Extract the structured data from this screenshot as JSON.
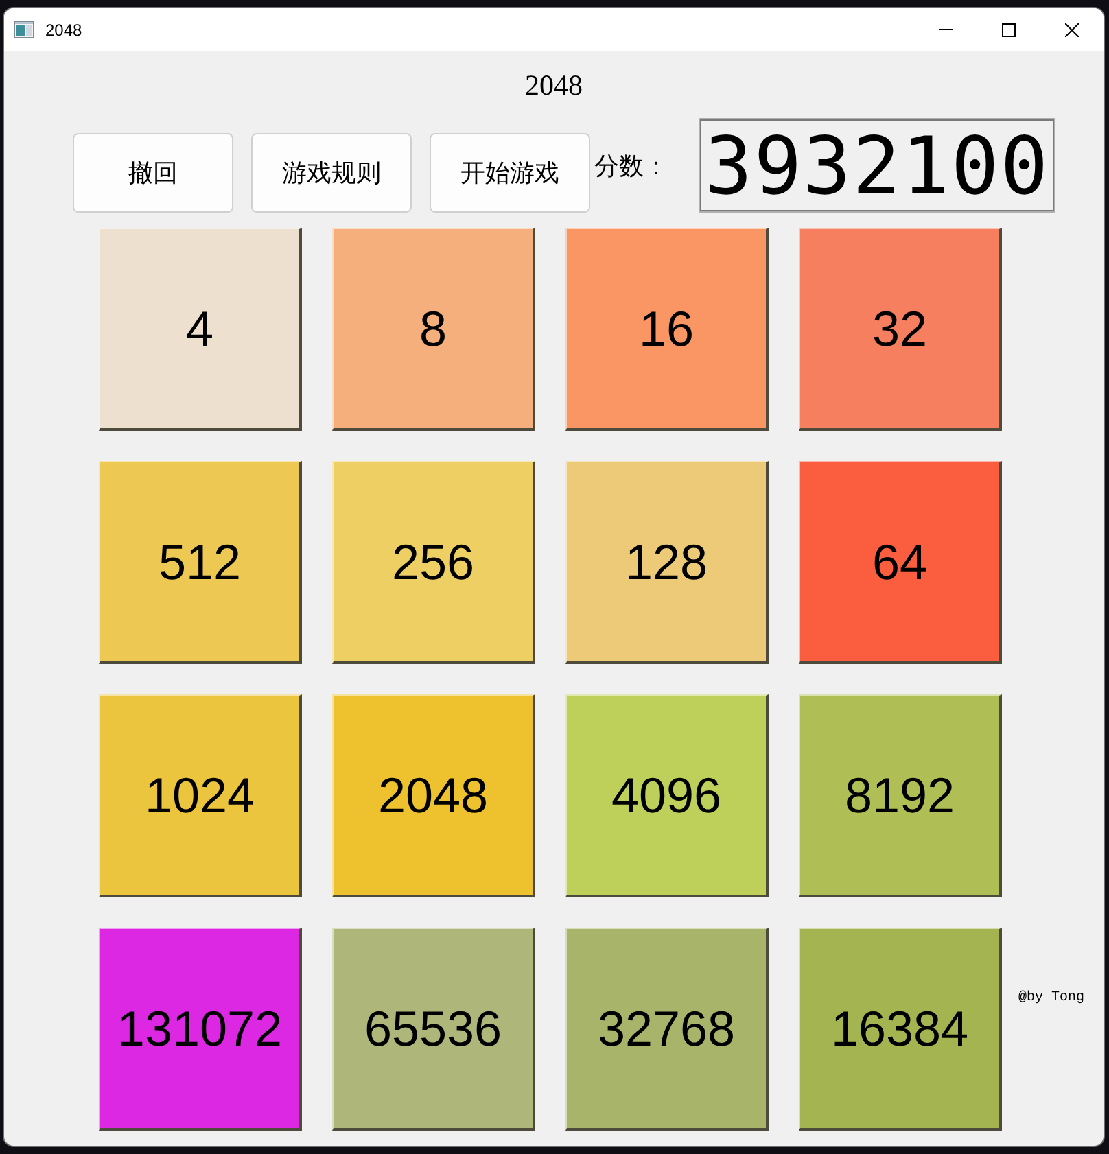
{
  "window": {
    "title": "2048"
  },
  "heading": "2048",
  "buttons": [
    "撤回",
    "游戏规则",
    "开始游戏"
  ],
  "score": {
    "label": "分数：",
    "value": "3932100"
  },
  "tiles": [
    {
      "value": "4",
      "color": "#eee0cf"
    },
    {
      "value": "8",
      "color": "#f4af7c"
    },
    {
      "value": "16",
      "color": "#f99664"
    },
    {
      "value": "32",
      "color": "#f57f5f"
    },
    {
      "value": "512",
      "color": "#edc853"
    },
    {
      "value": "256",
      "color": "#edcf63"
    },
    {
      "value": "128",
      "color": "#ecca78"
    },
    {
      "value": "64",
      "color": "#fb5d3f"
    },
    {
      "value": "1024",
      "color": "#ecc53e"
    },
    {
      "value": "2048",
      "color": "#edc22e"
    },
    {
      "value": "4096",
      "color": "#bed05a"
    },
    {
      "value": "8192",
      "color": "#b0bf55"
    },
    {
      "value": "131072",
      "color": "#dd28e3"
    },
    {
      "value": "65536",
      "color": "#aeb67a"
    },
    {
      "value": "32768",
      "color": "#a8b469"
    },
    {
      "value": "16384",
      "color": "#a4b451"
    }
  ],
  "credit": "@by Tong"
}
